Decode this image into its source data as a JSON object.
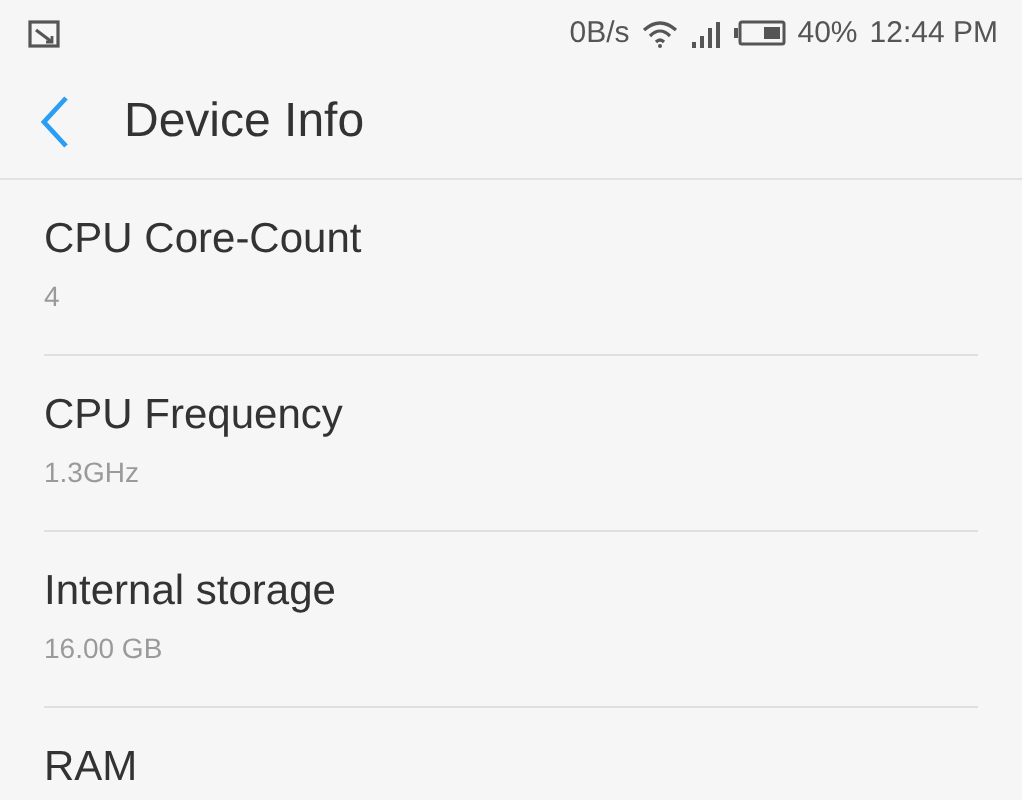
{
  "status_bar": {
    "speed": "0B/s",
    "battery": "40%",
    "time": "12:44 PM"
  },
  "header": {
    "title": "Device Info"
  },
  "items": [
    {
      "label": "CPU Core-Count",
      "value": "4"
    },
    {
      "label": "CPU Frequency",
      "value": "1.3GHz"
    },
    {
      "label": "Internal storage",
      "value": "16.00 GB"
    },
    {
      "label": "RAM"
    }
  ]
}
